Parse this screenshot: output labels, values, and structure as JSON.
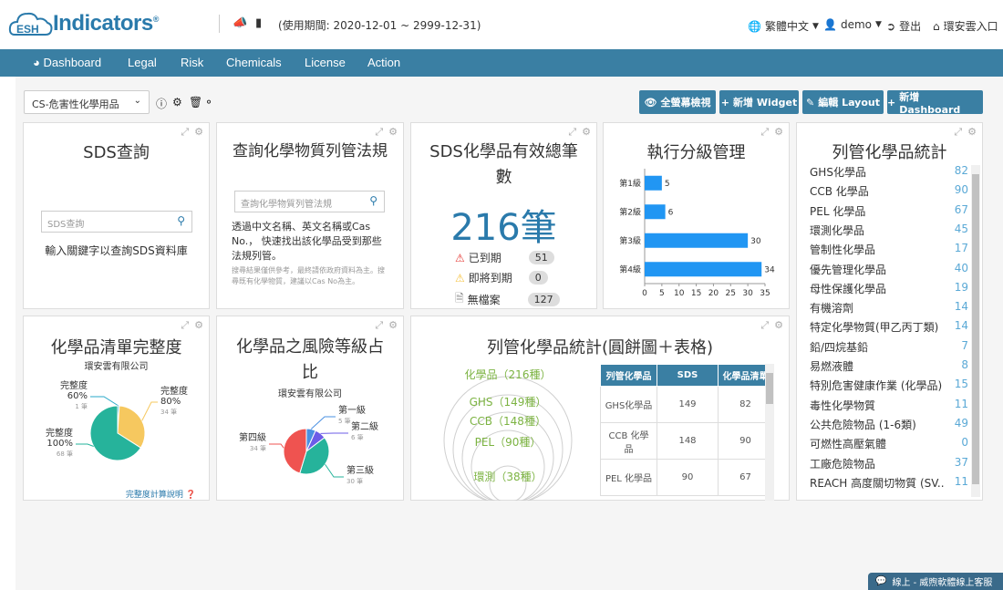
{
  "brand": {
    "name": "Indicators",
    "logo_text": "ESH",
    "reg": "®"
  },
  "header": {
    "usage_period": "(使用期間: 2020-12-01 ~ 2999-12-31)",
    "language": "繁體中文",
    "user": "demo",
    "logout": "登出",
    "portal": "環安雲入口"
  },
  "nav": {
    "items": [
      "Dashboard",
      "Legal",
      "Risk",
      "Chemicals",
      "License",
      "Action"
    ]
  },
  "toolbar": {
    "dashboard_select": "CS-危害性化學用品",
    "buttons": {
      "fullscreen": "全螢幕檢視",
      "add_widget": "新增 Widget",
      "edit_layout": "編輯 Layout",
      "add_dashboard": "新增 Dashboard"
    }
  },
  "sds_query": {
    "title": "SDS查詢",
    "placeholder": "SDS查詢",
    "hint": "輸入關鍵字以查詢SDS資料庫"
  },
  "reg_query": {
    "title": "查詢化學物質列管法規",
    "placeholder": "查詢化學物質列管法規",
    "desc": "透過中文名稱、英文名稱或Cas No.， 快速找出該化學品受到那些法規列管。",
    "note": "搜尋結果僅供參考，最終請依政府資料為主。搜尋既有化學物質，建議以Cas No為主。"
  },
  "sds_count": {
    "title": "SDS化學品有效總筆數",
    "total": "216筆",
    "rows": [
      {
        "label": "已到期",
        "count": "51"
      },
      {
        "label": "即將到期",
        "count": "0"
      },
      {
        "label": "無檔案",
        "count": "127"
      }
    ]
  },
  "level_mgmt": {
    "title": "執行分級管理",
    "chart_data": {
      "type": "bar",
      "orientation": "horizontal",
      "categories": [
        "第1級",
        "第2級",
        "第3級",
        "第4級"
      ],
      "values": [
        5,
        6,
        30,
        34
      ],
      "xlim": [
        0,
        35
      ],
      "xticks": [
        0,
        5,
        10,
        15,
        20,
        25,
        30,
        35
      ],
      "color": "#2196f3"
    }
  },
  "reg_stats": {
    "title": "列管化學品統計",
    "items": [
      {
        "label": "GHS化學品",
        "value": "82"
      },
      {
        "label": "CCB 化學品",
        "value": "90"
      },
      {
        "label": "PEL 化學品",
        "value": "67"
      },
      {
        "label": "環測化學品",
        "value": "45"
      },
      {
        "label": "管制性化學品",
        "value": "17"
      },
      {
        "label": "優先管理化學品",
        "value": "40"
      },
      {
        "label": "母性保護化學品",
        "value": "19"
      },
      {
        "label": "有機溶劑",
        "value": "14"
      },
      {
        "label": "特定化學物質(甲乙丙丁類)",
        "value": "14"
      },
      {
        "label": "鉛/四烷基鉛",
        "value": "7"
      },
      {
        "label": "易燃液體",
        "value": "8"
      },
      {
        "label": "特別危害健康作業 (化學品)",
        "value": "15"
      },
      {
        "label": "毒性化學物質",
        "value": "11"
      },
      {
        "label": "公共危險物品 (1-6類)",
        "value": "49"
      },
      {
        "label": "可燃性高壓氣體",
        "value": "0"
      },
      {
        "label": "工廠危險物品",
        "value": "37"
      },
      {
        "label": "REACH 高度關切物質 (SV...",
        "value": "11"
      }
    ]
  },
  "completeness": {
    "title": "化學品清單完整度",
    "company": "環安雲有限公司",
    "link": "完整度計算說明",
    "chart_data": {
      "type": "pie",
      "slices": [
        {
          "name": "完整度 60%",
          "sub": "1 筆",
          "value": 1,
          "color": "#2aa9c9"
        },
        {
          "name": "完整度 80%",
          "sub": "34 筆",
          "value": 34,
          "color": "#f6c85f"
        },
        {
          "name": "完整度 100%",
          "sub": "68 筆",
          "value": 68,
          "color": "#26b39b"
        }
      ]
    }
  },
  "risk_ratio": {
    "title": "化學品之風險等級占比",
    "company": "環安雲有限公司",
    "chart_data": {
      "type": "pie",
      "slices": [
        {
          "name": "第一級",
          "sub": "5 筆",
          "value": 5,
          "color": "#4a90e2"
        },
        {
          "name": "第二級",
          "sub": "6 筆",
          "value": 6,
          "color": "#6c5ce7"
        },
        {
          "name": "第三級",
          "sub": "30 筆",
          "value": 30,
          "color": "#26b39b"
        },
        {
          "name": "第四級",
          "sub": "34 筆",
          "value": 34,
          "color": "#ef5350"
        }
      ]
    }
  },
  "pie_table": {
    "title": "列管化學品統計(圓餅圖＋表格)",
    "circles": [
      {
        "label": "化學品（216種）"
      },
      {
        "label": "GHS（149種）"
      },
      {
        "label": "CCB（148種）"
      },
      {
        "label": "PEL（90種）"
      },
      {
        "label": "環測（38種）"
      }
    ],
    "table": {
      "headers": [
        "列管化學品",
        "SDS",
        "化學品清單"
      ],
      "rows": [
        [
          "GHS化學品",
          "149",
          "82"
        ],
        [
          "CCB 化學品",
          "148",
          "90"
        ],
        [
          "PEL 化學品",
          "90",
          "67"
        ]
      ]
    }
  },
  "chat": {
    "label": "線上 - 威煦軟體線上客服"
  }
}
